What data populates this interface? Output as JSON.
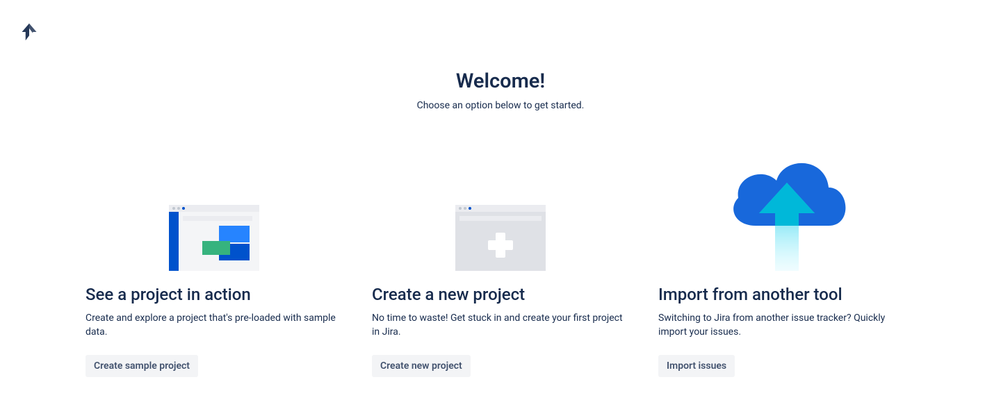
{
  "header": {
    "title": "Welcome!",
    "subtitle": "Choose an option below to get started."
  },
  "cards": [
    {
      "title": "See a project in action",
      "description": "Create and explore a project that's pre-loaded with sample data.",
      "button_label": "Create sample project"
    },
    {
      "title": "Create a new project",
      "description": "No time to waste! Get stuck in and create your first project in Jira.",
      "button_label": "Create new project"
    },
    {
      "title": "Import from another tool",
      "description": "Switching to Jira from another issue tracker? Quickly import your issues.",
      "button_label": "Import issues"
    }
  ]
}
